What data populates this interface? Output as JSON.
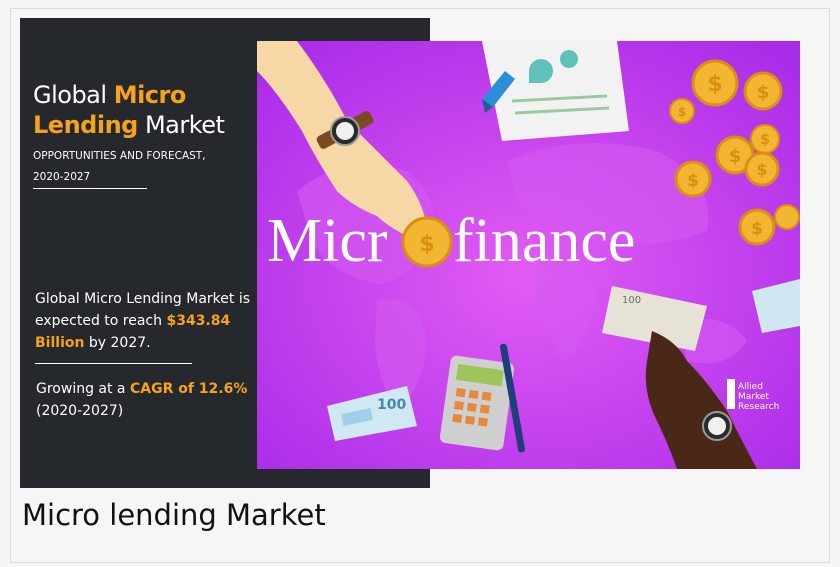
{
  "banner": {
    "title_part1": "Global ",
    "title_accent1": "Micro",
    "title_accent2": "Lending",
    "title_part2": " Market",
    "subtitle_line1": "OPPORTUNITIES AND FORECAST,",
    "subtitle_line2": "2020-2027",
    "stat1_text": "Global Micro Lending Market is expected to reach ",
    "stat1_value": "$343.84 Billion",
    "stat1_suffix": " by 2027.",
    "stat2_prefix": "Growing at a ",
    "stat2_value": "CAGR of 12.6%",
    "stat2_suffix": " (2020-2027)",
    "accent_color": "#f7a21b",
    "panel_color": "#25282c"
  },
  "illustration": {
    "headline_before": "Micr",
    "headline_after": "finance",
    "coin_symbol": "$",
    "banknote_value": "100",
    "brand_line1": "Allied",
    "brand_line2": "Market",
    "brand_line3": "Research",
    "background_color": "#c23ef0",
    "coin_color": "#f2b632"
  },
  "caption": "Micro lending Market"
}
